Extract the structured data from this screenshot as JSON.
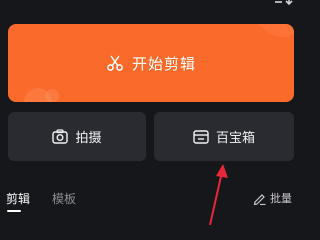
{
  "main_action": {
    "label": "开始剪辑",
    "icon": "scissors-icon",
    "color": "#fa6a2a"
  },
  "tools": [
    {
      "label": "拍摄",
      "icon": "camera-icon"
    },
    {
      "label": "百宝箱",
      "icon": "toolbox-icon"
    }
  ],
  "tabs": [
    {
      "label": "剪辑",
      "active": true
    },
    {
      "label": "模板",
      "active": false
    }
  ],
  "batch": {
    "label": "批量",
    "icon": "pencil-icon"
  },
  "annotation": {
    "arrow_color": "#e8273a"
  }
}
